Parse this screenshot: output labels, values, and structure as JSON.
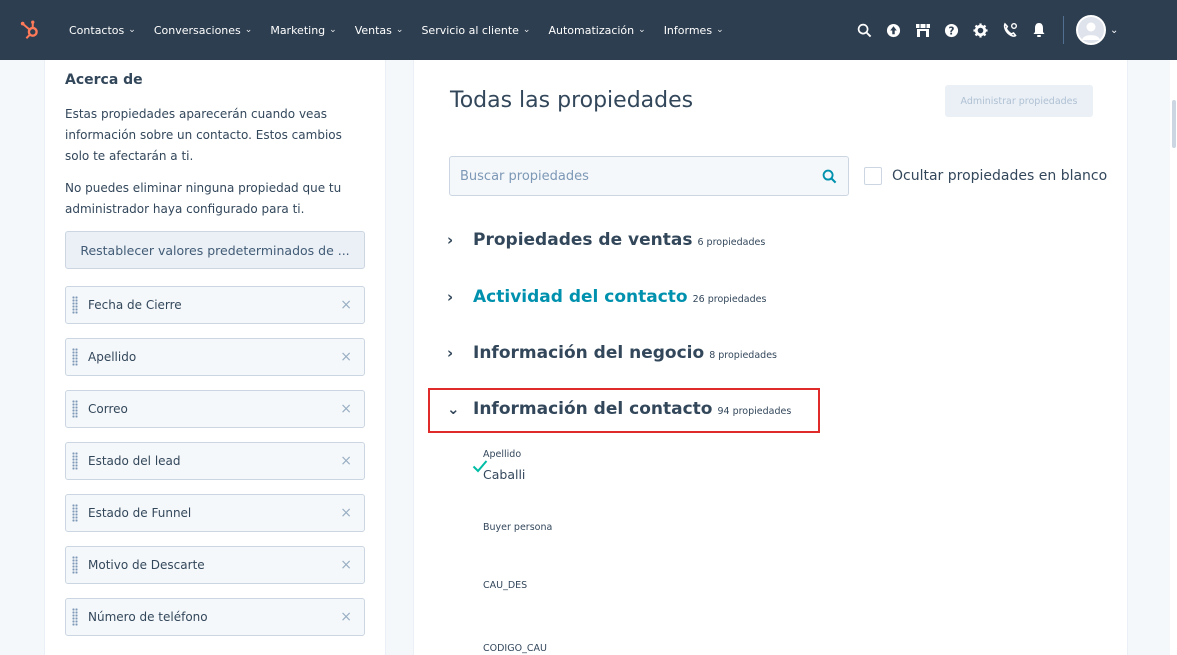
{
  "nav": {
    "items": [
      {
        "label": "Contactos",
        "caret": "⌄"
      },
      {
        "label": "Conversaciones",
        "caret": "⌄"
      },
      {
        "label": "Marketing",
        "caret": "⌄"
      },
      {
        "label": "Ventas",
        "caret": "⌄"
      },
      {
        "label": "Servicio al cliente",
        "caret": "⌄"
      },
      {
        "label": "Automatización",
        "caret": "⌄"
      },
      {
        "label": "Informes",
        "caret": "⌄"
      }
    ],
    "icons": [
      "search-icon",
      "upgrade-icon",
      "marketplace-icon",
      "help-icon",
      "settings-icon",
      "calling-icon",
      "notifications-icon"
    ],
    "brand_color": "#ff7a59",
    "bar_color": "#2d3e50"
  },
  "about": {
    "title": "Acerca de",
    "description": "Estas propiedades aparecerán cuando veas información sobre un contacto. Estos cambios solo te afectarán a ti.",
    "note": "No puedes eliminar ninguna propiedad que tu administrador haya configurado para ti.",
    "reset_label": "Restablecer valores predeterminados de ...",
    "properties": [
      {
        "label": "Fecha de Cierre",
        "remove": "×"
      },
      {
        "label": "Apellido",
        "remove": "×"
      },
      {
        "label": "Correo",
        "remove": "×"
      },
      {
        "label": "Estado del lead",
        "remove": "×"
      },
      {
        "label": "Estado de Funnel",
        "remove": "×"
      },
      {
        "label": "Motivo de Descarte",
        "remove": "×"
      },
      {
        "label": "Número de teléfono",
        "remove": "×"
      }
    ]
  },
  "all_props": {
    "title": "Todas las propiedades",
    "manage_label": "Administrar propiedades",
    "search_placeholder": "Buscar propiedades",
    "hide_blank_label": "Ocultar propiedades en blanco",
    "groups": [
      {
        "name": "Propiedades de ventas",
        "count": "6 propiedades",
        "chev": "›"
      },
      {
        "name": "Actividad del contacto",
        "count": "26 propiedades",
        "chev": "›"
      },
      {
        "name": "Información del negocio",
        "count": "8 propiedades",
        "chev": "›"
      },
      {
        "name": "Información del contacto",
        "count": "94 propiedades",
        "chev": "⌄"
      }
    ],
    "fields": [
      {
        "label": "Apellido",
        "value": "Caballi",
        "checked": true
      },
      {
        "label": "Buyer persona",
        "value": ""
      },
      {
        "label": "CAU_DES",
        "value": ""
      },
      {
        "label": "CODIGO_CAU",
        "value": ""
      }
    ],
    "highlight_color": "#e02b2b",
    "accent_color": "#00a4bd"
  }
}
